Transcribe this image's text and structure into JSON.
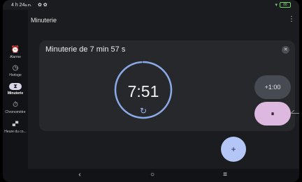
{
  "status_bar": {
    "time": "4 h 24",
    "time_suffix": "a.m.",
    "notification_icons": "✿ ✿",
    "battery": "88"
  },
  "app": {
    "title": "Minuterie"
  },
  "nav_rail": {
    "items": [
      {
        "label": "Alarme",
        "icon": "alarm-icon",
        "glyph": "⏰"
      },
      {
        "label": "Horloge",
        "icon": "clock-icon",
        "glyph": "◷"
      },
      {
        "label": "Minuterie",
        "icon": "hourglass-icon",
        "glyph": "⧗",
        "active": true
      },
      {
        "label": "Chronomètre",
        "icon": "stopwatch-icon",
        "glyph": "⏱"
      },
      {
        "label": "Heure du co...",
        "icon": "bed-icon",
        "glyph": "▄▀"
      }
    ]
  },
  "timer": {
    "title": "Minuterie de 7 min 57 s",
    "remaining": "7:51",
    "progress_fraction": 0.987,
    "add_minute_label": "+1:00",
    "pause_glyph": "⏸"
  },
  "colors": {
    "background": "#1b1c1f",
    "card": "#26282c",
    "ring": "#8aa9e6",
    "pause_button": "#ddb8df",
    "fab": "#b3c6f5"
  },
  "fab": {
    "label": "+"
  },
  "bottom_nav": {
    "back": "‹",
    "home": "○",
    "recents": "≡"
  }
}
